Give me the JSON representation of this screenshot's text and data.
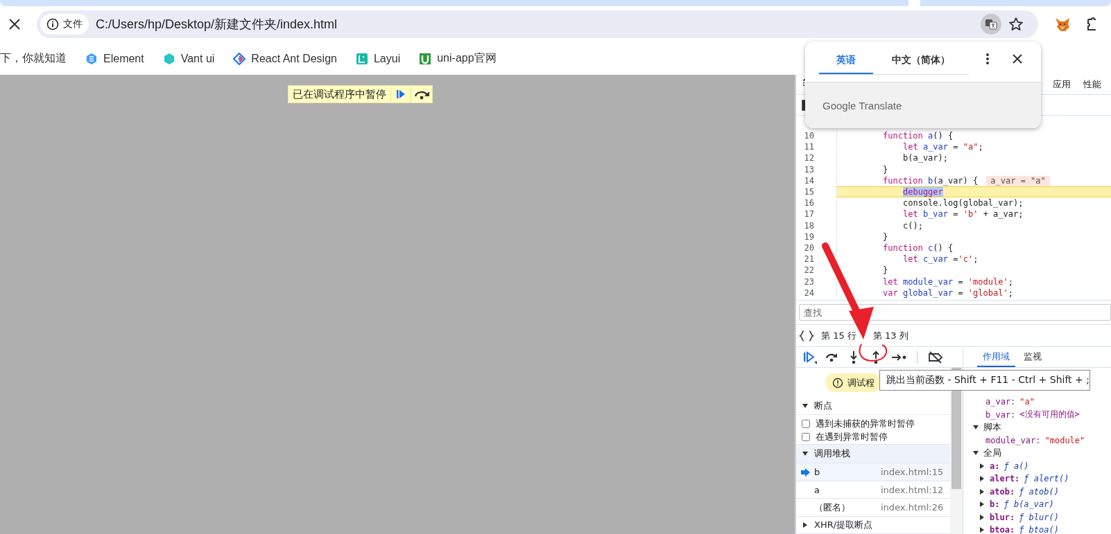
{
  "browser": {
    "address_bar": {
      "security_label": "文件",
      "url": "C:/Users/hp/Desktop/新建文件夹/index.html"
    },
    "bookmarks": [
      {
        "label": "下，你就知道"
      },
      {
        "label": "Element",
        "kind": "element"
      },
      {
        "label": "Vant ui",
        "kind": "vant"
      },
      {
        "label": "React Ant Design",
        "kind": "antd"
      },
      {
        "label": "Layui",
        "kind": "layui"
      },
      {
        "label": "uni-app官网",
        "kind": "uniapp"
      }
    ]
  },
  "paused_overlay": {
    "label": "已在调试程序中暂停"
  },
  "translate_popup": {
    "tabs": [
      {
        "label": "英语",
        "selected": true
      },
      {
        "label": "中文（简体）",
        "selected": false
      }
    ],
    "footer": "Google Translate"
  },
  "devtools": {
    "panel_tabs": [
      {
        "label": "应用"
      },
      {
        "label": "性能"
      }
    ],
    "code": {
      "lines": [
        {
          "number": "10",
          "current": false,
          "indented": false,
          "tokens": [
            {
              "text": "function",
              "kind": "kw"
            },
            {
              "text": " a",
              "kind": "def"
            },
            {
              "text": "() {",
              "kind": "plain"
            }
          ]
        },
        {
          "number": "11",
          "current": false,
          "indented": true,
          "tokens": [
            {
              "text": "let",
              "kind": "kw"
            },
            {
              "text": " a_var",
              "kind": "def"
            },
            {
              "text": " = ",
              "kind": "plain"
            },
            {
              "text": "\"a\"",
              "kind": "str"
            },
            {
              "text": ";",
              "kind": "plain"
            }
          ]
        },
        {
          "number": "12",
          "current": false,
          "indented": true,
          "tokens": [
            {
              "text": "b(a_var);",
              "kind": "plain"
            }
          ]
        },
        {
          "number": "13",
          "current": false,
          "indented": false,
          "tokens": [
            {
              "text": "}",
              "kind": "plain"
            }
          ]
        },
        {
          "number": "14",
          "current": false,
          "indented": false,
          "tokens": [
            {
              "text": "function",
              "kind": "kw"
            },
            {
              "text": " b",
              "kind": "def"
            },
            {
              "text": "(a_var) {",
              "kind": "plain"
            }
          ],
          "inline_value": "a_var = \"a\""
        },
        {
          "number": "15",
          "current": true,
          "indented": true,
          "tokens": [
            {
              "text": "debugger",
              "kind": "selection"
            }
          ]
        },
        {
          "number": "16",
          "current": false,
          "indented": true,
          "tokens": [
            {
              "text": "console.log(global_var);",
              "kind": "plain"
            }
          ]
        },
        {
          "number": "17",
          "current": false,
          "indented": true,
          "tokens": [
            {
              "text": "let",
              "kind": "kw"
            },
            {
              "text": " b_var",
              "kind": "def"
            },
            {
              "text": " = ",
              "kind": "plain"
            },
            {
              "text": "'b'",
              "kind": "str"
            },
            {
              "text": " + a_var;",
              "kind": "plain"
            }
          ]
        },
        {
          "number": "18",
          "current": false,
          "indented": true,
          "tokens": [
            {
              "text": "c();",
              "kind": "plain"
            }
          ]
        },
        {
          "number": "19",
          "current": false,
          "indented": false,
          "tokens": [
            {
              "text": "}",
              "kind": "plain"
            }
          ]
        },
        {
          "number": "20",
          "current": false,
          "indented": false,
          "tokens": [
            {
              "text": "function",
              "kind": "kw"
            },
            {
              "text": " c",
              "kind": "def"
            },
            {
              "text": "() {",
              "kind": "plain"
            }
          ]
        },
        {
          "number": "21",
          "current": false,
          "indented": true,
          "tokens": [
            {
              "text": "let",
              "kind": "kw"
            },
            {
              "text": " c_var",
              "kind": "def"
            },
            {
              "text": " =",
              "kind": "plain"
            },
            {
              "text": "'c'",
              "kind": "str"
            },
            {
              "text": ";",
              "kind": "plain"
            }
          ]
        },
        {
          "number": "22",
          "current": false,
          "indented": false,
          "tokens": [
            {
              "text": "}",
              "kind": "plain"
            }
          ]
        },
        {
          "number": "23",
          "current": false,
          "indented": false,
          "tokens": [
            {
              "text": "let",
              "kind": "kw"
            },
            {
              "text": " module_var",
              "kind": "def"
            },
            {
              "text": " = ",
              "kind": "plain"
            },
            {
              "text": "'module'",
              "kind": "str"
            },
            {
              "text": ";",
              "kind": "plain"
            }
          ]
        },
        {
          "number": "24",
          "current": false,
          "indented": false,
          "tokens": [
            {
              "text": "var",
              "kind": "kw"
            },
            {
              "text": " global_var",
              "kind": "def"
            },
            {
              "text": " = ",
              "kind": "plain"
            },
            {
              "text": "'global'",
              "kind": "str"
            },
            {
              "text": ";",
              "kind": "plain"
            }
          ]
        }
      ]
    },
    "search": {
      "placeholder": "查找"
    },
    "cursor_position": [
      "第 15 行",
      "第 13 列"
    ],
    "paused_badge": "调试程",
    "tooltip": "跳出当前函数 - Shift + F11 - Ctrl + Shift + ;",
    "breakpoints": {
      "title": "断点",
      "expanded": true,
      "options": [
        {
          "label": "遇到未捕获的异常时暂停",
          "checked": false
        },
        {
          "label": "在遇到异常时暂停",
          "checked": false
        }
      ]
    },
    "call_stack": {
      "title": "调用堆栈",
      "expanded": true,
      "frames": [
        {
          "name": "b",
          "location": "index.html:15",
          "selected": true
        },
        {
          "name": "a",
          "location": "index.html:12",
          "selected": false
        },
        {
          "name": "（匿名）",
          "location": "index.html:26",
          "selected": false
        }
      ]
    },
    "xhr_breakpoints": {
      "title": "XHR/提取断点",
      "expanded": false
    },
    "side_tabs": [
      {
        "label": "作用域",
        "selected": true
      },
      {
        "label": "监视",
        "selected": false
      }
    ],
    "scope": {
      "local_vars": [
        {
          "name": "a_var:",
          "value": "\"a\"",
          "kind": "string"
        },
        {
          "name": "b_var:",
          "value": "<没有可用的值>",
          "kind": "unavailable"
        }
      ],
      "sections": [
        {
          "title": "脚本",
          "expanded": true,
          "vars": [
            {
              "name": "module_var:",
              "value": "\"module\"",
              "kind": "string"
            }
          ]
        },
        {
          "title": "全局",
          "expanded": true,
          "vars": [
            {
              "name": "a:",
              "value": "ƒ a()",
              "kind": "function",
              "expanded": false
            },
            {
              "name": "alert:",
              "value": "ƒ alert()",
              "kind": "function",
              "expanded": false
            },
            {
              "name": "atob:",
              "value": "ƒ atob()",
              "kind": "function",
              "expanded": false
            },
            {
              "name": "b:",
              "value": "ƒ b(a_var)",
              "kind": "function",
              "expanded": false
            },
            {
              "name": "blur:",
              "value": "ƒ blur()",
              "kind": "function",
              "expanded": false
            },
            {
              "name": "btoa:",
              "value": "ƒ btoa()",
              "kind": "function",
              "expanded": false
            }
          ]
        }
      ]
    }
  },
  "annotations": [
    {
      "kind": "arrow"
    },
    {
      "kind": "circle"
    }
  ]
}
